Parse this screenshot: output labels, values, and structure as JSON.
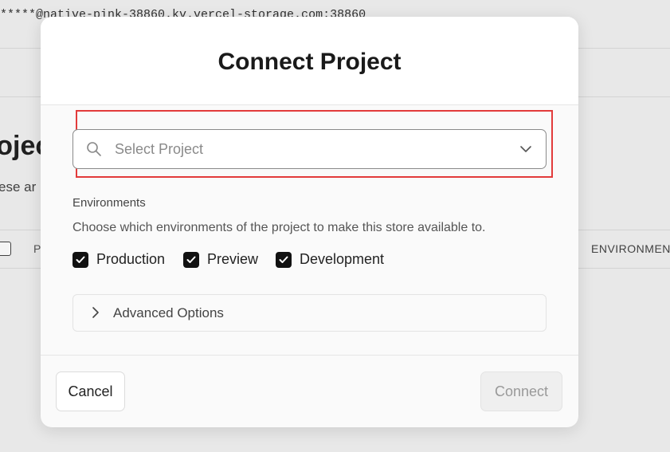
{
  "background": {
    "connection_string": "*****@native-pink-38860.kv.vercel-storage.com:38860",
    "page_title_fragment": "rojec",
    "description_fragment": "ese ar",
    "column_p": "P",
    "column_environments": "ENVIRONMENTS"
  },
  "modal": {
    "title": "Connect Project",
    "project_select": {
      "placeholder": "Select Project",
      "icon": "search-icon",
      "dropdown_icon": "chevron-down-icon"
    },
    "environments": {
      "label": "Environments",
      "description": "Choose which environments of the project to make this store available to.",
      "options": [
        {
          "label": "Production",
          "checked": true
        },
        {
          "label": "Preview",
          "checked": true
        },
        {
          "label": "Development",
          "checked": true
        }
      ]
    },
    "advanced_options": {
      "label": "Advanced Options",
      "icon": "chevron-right-icon"
    },
    "buttons": {
      "cancel": "Cancel",
      "connect": "Connect"
    }
  },
  "colors": {
    "highlight": "#e23b3b",
    "checkbox": "#111111"
  }
}
